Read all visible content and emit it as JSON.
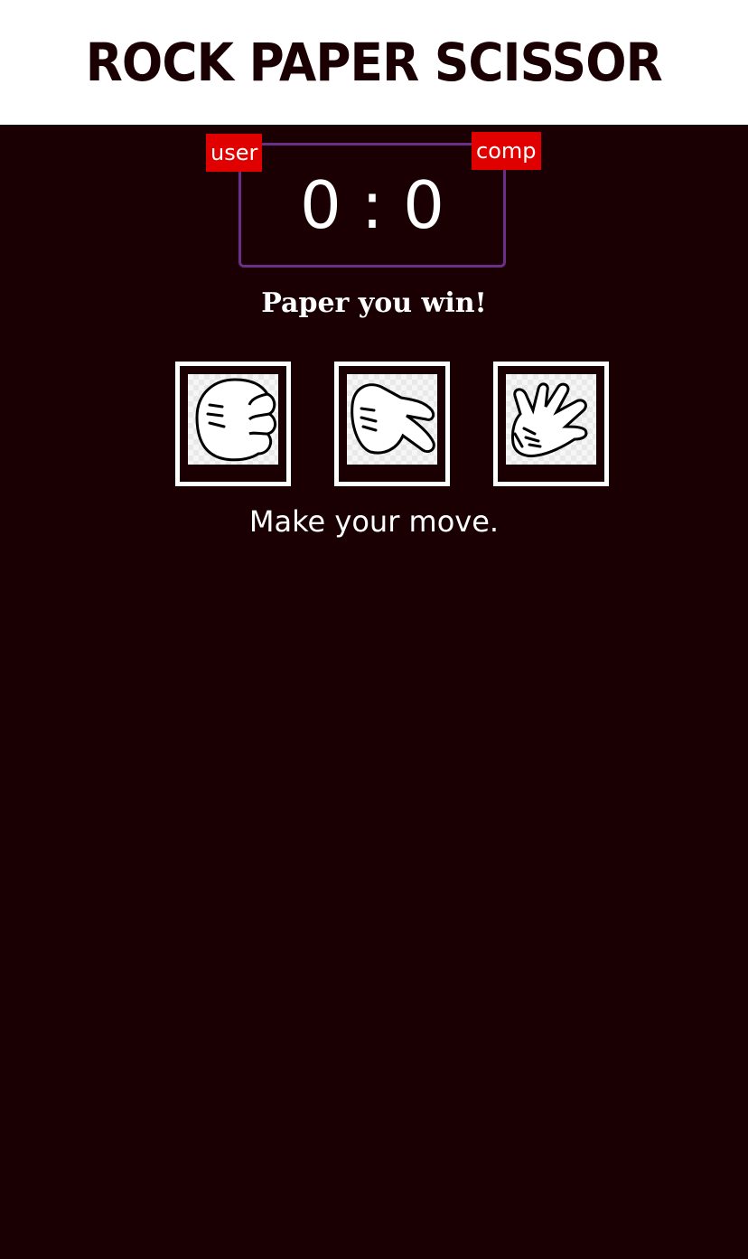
{
  "header": {
    "title": "ROCK PAPER SCISSOR"
  },
  "scoreboard": {
    "user_label": "user",
    "comp_label": "comp",
    "user_score": "0",
    "separator": ":",
    "comp_score": "0"
  },
  "result": {
    "message": "Paper you win!"
  },
  "choices": [
    {
      "icon": "rock-fist-icon"
    },
    {
      "icon": "scissors-hand-icon"
    },
    {
      "icon": "paper-hand-icon"
    }
  ],
  "prompt": {
    "text": "Make your move."
  },
  "colors": {
    "background": "#1a0002",
    "header_bg": "#ffffff",
    "badge": "#e10000",
    "scoreboard_border": "#6b2f8a"
  }
}
